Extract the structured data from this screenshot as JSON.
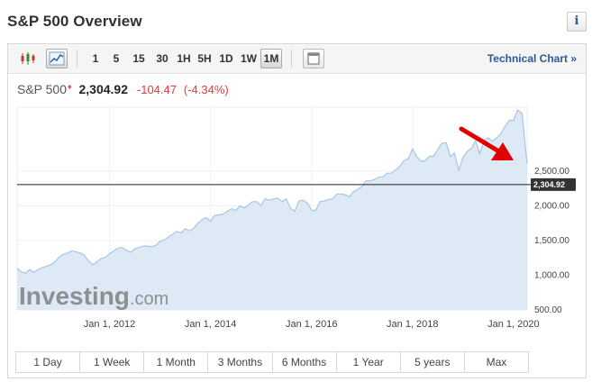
{
  "header": {
    "title": "S&P 500 Overview",
    "info_label": "i"
  },
  "toolbar": {
    "intervals": [
      "1",
      "5",
      "15",
      "30",
      "1H",
      "5H",
      "1D",
      "1W",
      "1M"
    ],
    "active_interval": "1M",
    "technical_chart": "Technical Chart »"
  },
  "quote": {
    "name": "S&P 500",
    "marker": "♦",
    "price": "2,304.92",
    "change": "-104.47",
    "change_pct": "(-4.34%)"
  },
  "colors": {
    "negative": "#e23b3b",
    "link": "#2a5a9c",
    "area_fill": "#dde9f5",
    "line": "#a8c6e4",
    "arrow": "#e00000"
  },
  "watermark": {
    "brand": "Investing",
    "suffix": ".com"
  },
  "chart_data": {
    "type": "area",
    "x_tick_labels": [
      "Jan 1, 2012",
      "Jan 1, 2014",
      "Jan 1, 2016",
      "Jan 1, 2018",
      "Jan 1, 2020"
    ],
    "x_tick_years": [
      2012,
      2014,
      2016,
      2018,
      2020
    ],
    "y_tick_labels": [
      "500.00",
      "1,000.00",
      "1,500.00",
      "2,000.00",
      "2,500.00"
    ],
    "y_tick_values": [
      500,
      1000,
      1500,
      2000,
      2500
    ],
    "ylim": [
      500,
      3420
    ],
    "xlim": [
      2010.17,
      2020.27
    ],
    "current_value": 2304.92,
    "current_label": "2,304.92",
    "series": [
      {
        "x": [
          2010.17,
          2010.25,
          2010.33,
          2010.42,
          2010.5,
          2010.58,
          2010.67,
          2010.75,
          2010.83,
          2010.92,
          2011.0,
          2011.08,
          2011.17,
          2011.25,
          2011.33,
          2011.42,
          2011.5,
          2011.58,
          2011.67,
          2011.75,
          2011.83,
          2011.92,
          2012.0,
          2012.08,
          2012.17,
          2012.25,
          2012.33,
          2012.42,
          2012.5,
          2012.58,
          2012.67,
          2012.75,
          2012.83,
          2012.92,
          2013.0,
          2013.08,
          2013.17,
          2013.25,
          2013.33,
          2013.42,
          2013.5,
          2013.58,
          2013.67,
          2013.75,
          2013.83,
          2013.92,
          2014.0,
          2014.08,
          2014.17,
          2014.25,
          2014.33,
          2014.42,
          2014.5,
          2014.58,
          2014.67,
          2014.75,
          2014.83,
          2014.92,
          2015.0,
          2015.08,
          2015.17,
          2015.25,
          2015.33,
          2015.42,
          2015.5,
          2015.58,
          2015.67,
          2015.75,
          2015.83,
          2015.92,
          2016.0,
          2016.08,
          2016.17,
          2016.25,
          2016.33,
          2016.42,
          2016.5,
          2016.58,
          2016.67,
          2016.75,
          2016.83,
          2016.92,
          2017.0,
          2017.08,
          2017.17,
          2017.25,
          2017.33,
          2017.42,
          2017.5,
          2017.58,
          2017.67,
          2017.75,
          2017.83,
          2017.92,
          2018.0,
          2018.08,
          2018.17,
          2018.25,
          2018.33,
          2018.42,
          2018.5,
          2018.58,
          2018.67,
          2018.75,
          2018.83,
          2018.92,
          2019.0,
          2019.08,
          2019.17,
          2019.25,
          2019.33,
          2019.42,
          2019.5,
          2019.58,
          2019.67,
          2019.75,
          2019.83,
          2019.92,
          2020.0,
          2020.08,
          2020.17,
          2020.27
        ],
        "y": [
          1100,
          1050,
          1030,
          1080,
          1040,
          1080,
          1110,
          1130,
          1150,
          1190,
          1260,
          1300,
          1320,
          1350,
          1340,
          1320,
          1290,
          1210,
          1150,
          1190,
          1240,
          1260,
          1310,
          1350,
          1390,
          1400,
          1360,
          1330,
          1380,
          1400,
          1420,
          1420,
          1410,
          1430,
          1490,
          1510,
          1550,
          1590,
          1630,
          1610,
          1670,
          1640,
          1680,
          1750,
          1800,
          1830,
          1780,
          1860,
          1870,
          1880,
          1920,
          1960,
          1930,
          2000,
          1970,
          2010,
          2060,
          2060,
          2000,
          2100,
          2080,
          2100,
          2110,
          2060,
          2100,
          1970,
          1920,
          2070,
          2080,
          2040,
          1940,
          1930,
          2060,
          2070,
          2090,
          2100,
          2170,
          2170,
          2160,
          2130,
          2200,
          2240,
          2280,
          2360,
          2360,
          2380,
          2410,
          2420,
          2470,
          2470,
          2520,
          2570,
          2650,
          2680,
          2820,
          2710,
          2640,
          2650,
          2710,
          2720,
          2810,
          2900,
          2910,
          2710,
          2760,
          2510,
          2700,
          2780,
          2830,
          2940,
          2750,
          2940,
          2980,
          2930,
          2980,
          3040,
          3140,
          3230,
          3230,
          3380,
          3330,
          2600
        ]
      }
    ]
  },
  "ranges": [
    "1 Day",
    "1 Week",
    "1 Month",
    "3 Months",
    "6 Months",
    "1 Year",
    "5 years",
    "Max"
  ]
}
